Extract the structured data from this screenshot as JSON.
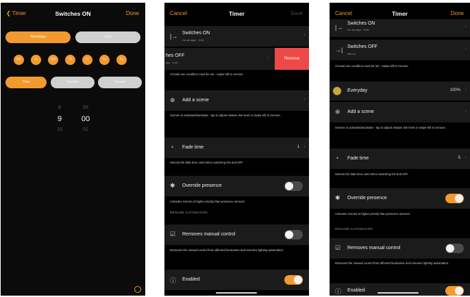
{
  "screen1": {
    "back_label": "Timer",
    "title": "Switches ON",
    "done_label": "Done",
    "mode_tabs": [
      "Weekdays",
      "Date"
    ],
    "days": [
      "Mo",
      "Tu",
      "We",
      "Th",
      "Fr",
      "Sa",
      "Su"
    ],
    "type_tabs": [
      "Time",
      "Sunrise",
      "Sunset"
    ],
    "picker_hours": [
      "8",
      "9",
      "10"
    ],
    "picker_minutes": [
      "59",
      "00",
      "01"
    ]
  },
  "screen2": {
    "cancel_label": "Cancel",
    "title": "Timer",
    "save_label": "Save",
    "switches_on": {
      "title": "Switches ON",
      "subtitle": "On all days · 9:00"
    },
    "switches_off": {
      "title": "hes OFF",
      "subtitle": "ays · 0:00"
    },
    "remove_label": "Remove",
    "condition_note": "At least one condition must be set - swipe left to remove.",
    "add_scene": "Add a scene",
    "add_scene_desc": "Scenes to activate/deactivate - tap to adjust relative dim level or swipe left to remove.",
    "fade_time": "Fade time",
    "fade_value": "1",
    "fade_desc": "Selects the fade time used when switching ON and OFF",
    "override_presence": "Override presence",
    "override_desc": "Activates scenes at higher priority than presence sensors.",
    "resume_header": "RESUME AUTOMATION",
    "remove_manual": "Removes manual control",
    "remove_manual_desc": "Removes the manual control from affected luminaires and resumes lighting automation.",
    "enabled": "Enabled"
  },
  "screen3": {
    "cancel_label": "Cancel",
    "title": "Timer",
    "done_label": "Done",
    "switches_on": {
      "title": "Switches ON",
      "subtitle": "On all days · 9:00"
    },
    "switches_off": {
      "title": "Switches OFF",
      "subtitle": "last on"
    },
    "condition_note": "At least one condition must be set - swipe left to remove.",
    "scene_name": "Everyday",
    "scene_value": "100%",
    "add_scene": "Add a scene",
    "add_scene_desc": "Scenes to activate/deactivate - tap to adjust relative dim level or swipe left to remove.",
    "fade_time": "Fade time",
    "fade_value": "5",
    "fade_desc": "Selects the fade time used when switching ON and OFF",
    "override_presence": "Override presence",
    "override_desc": "Activates scenes at higher priority than presence sensors.",
    "resume_header": "RESUME AUTOMATION",
    "remove_manual": "Removes manual control",
    "remove_manual_desc": "Removes the manual control from affected luminaires and resumes lighting automation.",
    "enabled": "Enabled"
  },
  "colors": {
    "accent": "#f29a2e",
    "danger": "#ef4848",
    "background": "#000000"
  }
}
